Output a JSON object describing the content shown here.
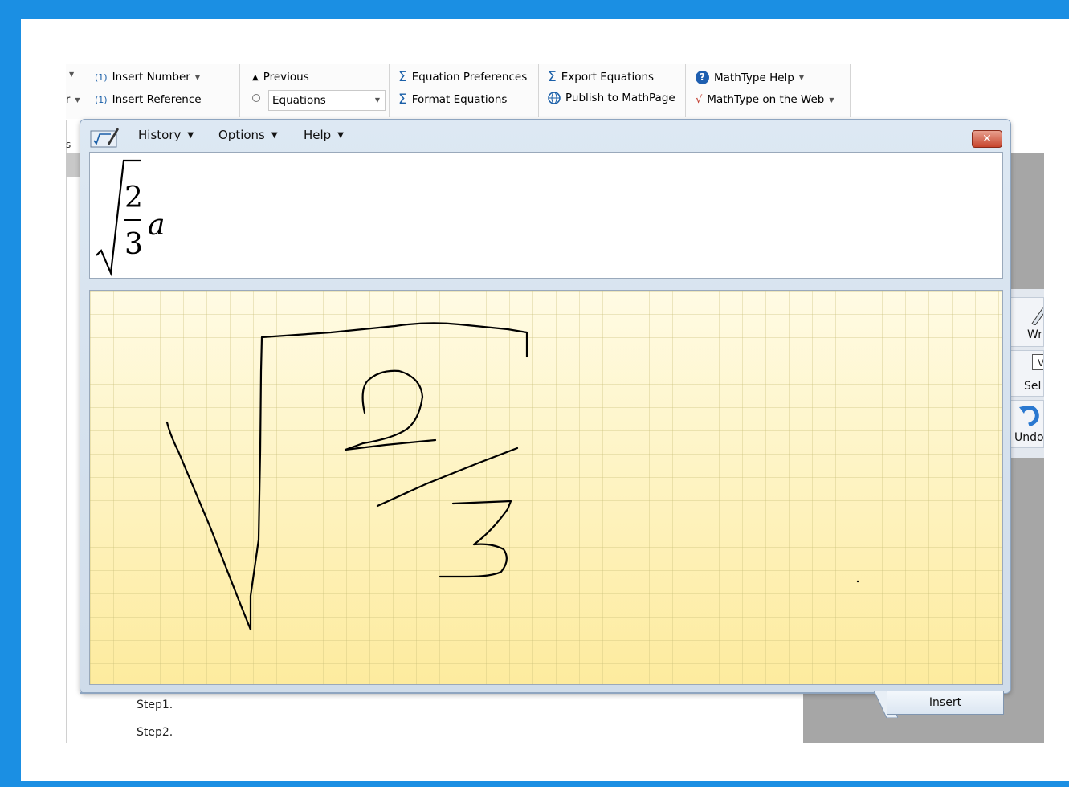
{
  "ribbon": {
    "insert_number": "Insert Number",
    "insert_number_icon": "(1)",
    "insert_reference": "Insert Reference",
    "insert_reference_icon": "(1)",
    "previous": "Previous",
    "equations_combo": "Equations",
    "equation_preferences": "Equation Preferences",
    "format_equations": "Format Equations",
    "export_equations": "Export Equations",
    "publish_mathpage": "Publish to MathPage",
    "mathtype_help": "MathType Help",
    "mathtype_web": "MathType on the Web",
    "left_cut_label": "s"
  },
  "dialog": {
    "menus": {
      "history": "History",
      "options": "Options",
      "help": "Help"
    },
    "preview": {
      "numerator": "2",
      "denominator": "3",
      "variable": "a"
    },
    "insert_button": "Insert"
  },
  "document": {
    "steps": [
      "Step1.",
      "Step2."
    ]
  },
  "side_panel": {
    "write_label": "Wr",
    "select_label": "Sel",
    "select_box": "V",
    "undo_label": "Undo"
  },
  "colors": {
    "frame": "#1b8fe3",
    "canvas": "#fdf6c9",
    "ink": "#000000"
  }
}
